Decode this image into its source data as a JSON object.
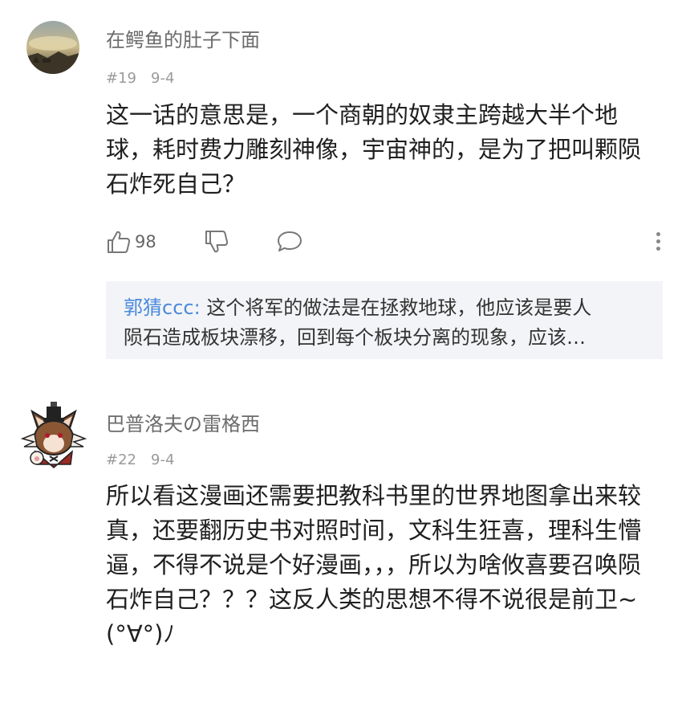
{
  "comments": [
    {
      "username": "在鳄鱼的肚子下面",
      "floor": "#19",
      "date": "9-4",
      "text": "这一话的意思是，一个商朝的奴隶主跨越大半个地球，耗时费力雕刻神像，宇宙神的，是为了把叫颗陨石炸死自己？",
      "likes": "98",
      "reply": {
        "author": "郭猜ccc:",
        "line1": "这个将军的做法是在拯救地球，他应该是要人",
        "line2": "陨石造成板块漂移，回到每个板块分离的现象，应该…"
      }
    },
    {
      "username": "巴普洛夫の雷格西",
      "floor": "#22",
      "date": "9-4",
      "text": "所以看这漫画还需要把教科书里的世界地图拿出来较真，还要翻历史书对照时间，文科生狂喜，理科生懵逼，不得不说是个好漫画，，，所以为啥攸喜要召唤陨石炸自己？？？这反人类的思想不得不说很是前卫~ (°∀°)ﾉ"
    }
  ],
  "icons": {
    "like": "thumbs-up-icon",
    "dislike": "thumbs-down-icon",
    "comment": "comment-bubble-icon",
    "more": "more-vertical-icon"
  },
  "colors": {
    "username": "#6b6b6b",
    "meta": "#9a9a9a",
    "reply_author": "#4a89dc",
    "reply_bg": "#f3f4f7"
  }
}
